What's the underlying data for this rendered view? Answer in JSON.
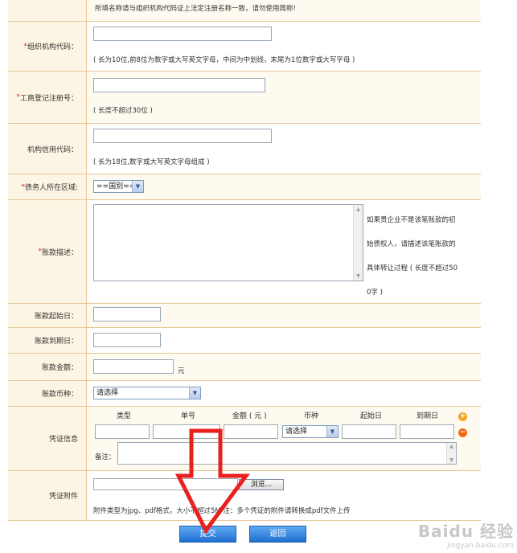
{
  "top_note": "所填名称请与组织机构代码证上法定注册名称一致，请勿使用简称!",
  "org_code": {
    "label": "组织机构代码：",
    "value": "",
    "hint": "( 长为10位,前8位为数字或大写英文字母，中间为中划线，末尾为1位数字或大写字母 )"
  },
  "business_reg": {
    "label": "工商登记注册号：",
    "value": "",
    "hint": "( 长度不超过30位 )"
  },
  "credit_code": {
    "label": "机构信用代码：",
    "value": "",
    "hint": "( 长为18位,数字或大写英文字母组成 )"
  },
  "debtor_region": {
    "label": "债务人所在区域:",
    "selected": "==国别=="
  },
  "debt_desc": {
    "label": "账款描述：",
    "value": "",
    "side_note": [
      "如果贵企业不是该笔账款的初",
      "始债权人，请描述该笔账款的",
      "具体转让过程 ( 长度不超过50",
      "0字 )"
    ]
  },
  "start_date": {
    "label": "账款起始日：",
    "value": ""
  },
  "end_date": {
    "label": "账款到期日：",
    "value": ""
  },
  "amount": {
    "label": "账款金额：",
    "value": "",
    "unit": "元"
  },
  "currency": {
    "label": "账款币种：",
    "selected": "请选择"
  },
  "voucher": {
    "label": "凭证信息",
    "columns": [
      "类型",
      "单号",
      "金额 ( 元 )",
      "币种",
      "起始日",
      "到期日"
    ],
    "currency_selected": "请选择",
    "remark_label": "备注："
  },
  "attachment": {
    "label": "凭证附件",
    "browse_label": "浏览...",
    "hint": "附件类型为jpg、pdf格式，大小不超过5M  注：多个凭证的附件请转换成pdf文件上传"
  },
  "actions": {
    "submit_label": "提交",
    "back_label": "返回"
  },
  "watermark": {
    "brand": "Baidu 经验",
    "url": "jingyan.baidu.com"
  },
  "colors": {
    "label_bg": "#fdf5e3",
    "border": "#e6c896",
    "required": "#e02020",
    "button": "#2a7fdc",
    "arrow": "#e8201e"
  }
}
